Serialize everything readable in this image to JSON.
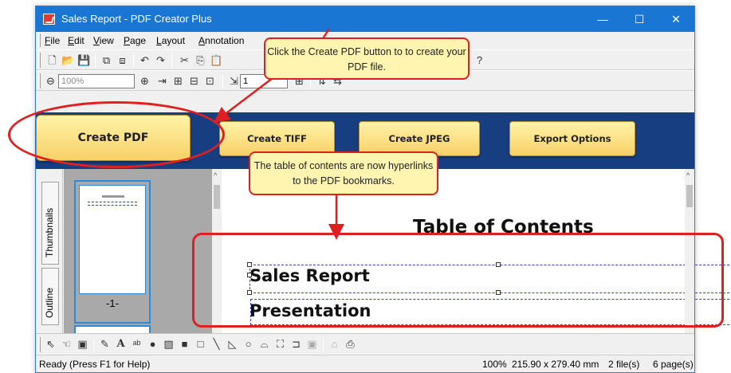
{
  "window": {
    "title": "Sales Report - PDF Creator Plus"
  },
  "window_controls": {
    "minimize": "—",
    "maximize": "☐",
    "close": "✕"
  },
  "menu": {
    "items": [
      {
        "pre": "",
        "ul": "F",
        "post": "ile"
      },
      {
        "pre": "",
        "ul": "E",
        "post": "dit"
      },
      {
        "pre": "",
        "ul": "V",
        "post": "iew"
      },
      {
        "pre": "",
        "ul": "P",
        "post": "age"
      },
      {
        "pre": "",
        "ul": "L",
        "post": "ayout"
      },
      {
        "pre": "",
        "ul": "A",
        "post": "nnotation"
      }
    ]
  },
  "toolbar2": {
    "zoom_value": "100%",
    "page_value": "1"
  },
  "actions": {
    "create_pdf": "Create PDF",
    "create_tiff": "Create TIFF",
    "create_jpeg": "Create JPEG",
    "export_options": "Export Options"
  },
  "sidetabs": {
    "thumbnails": "Thumbnails",
    "outline": "Outline"
  },
  "thumbnails": {
    "page_label": "-1-"
  },
  "document": {
    "heading": "Table of Contents",
    "entries": [
      "Sales Report",
      "Presentation"
    ]
  },
  "status": {
    "left": "Ready (Press F1 for Help)",
    "zoom": "100%",
    "size": "215.90 x 279.40 mm",
    "files": "2 file(s)",
    "pages": "6 page(s)"
  },
  "callouts": {
    "create_pdf_tip": "Click the Create PDF button to to create your PDF file.",
    "toc_tip": "The table of contents are now hyperlinks to the PDF bookmarks."
  },
  "colors": {
    "annotation_red": "#e02020",
    "callout_bg": "#fff4b0",
    "action_bar": "#173e80",
    "titlebar": "#1976d2"
  }
}
